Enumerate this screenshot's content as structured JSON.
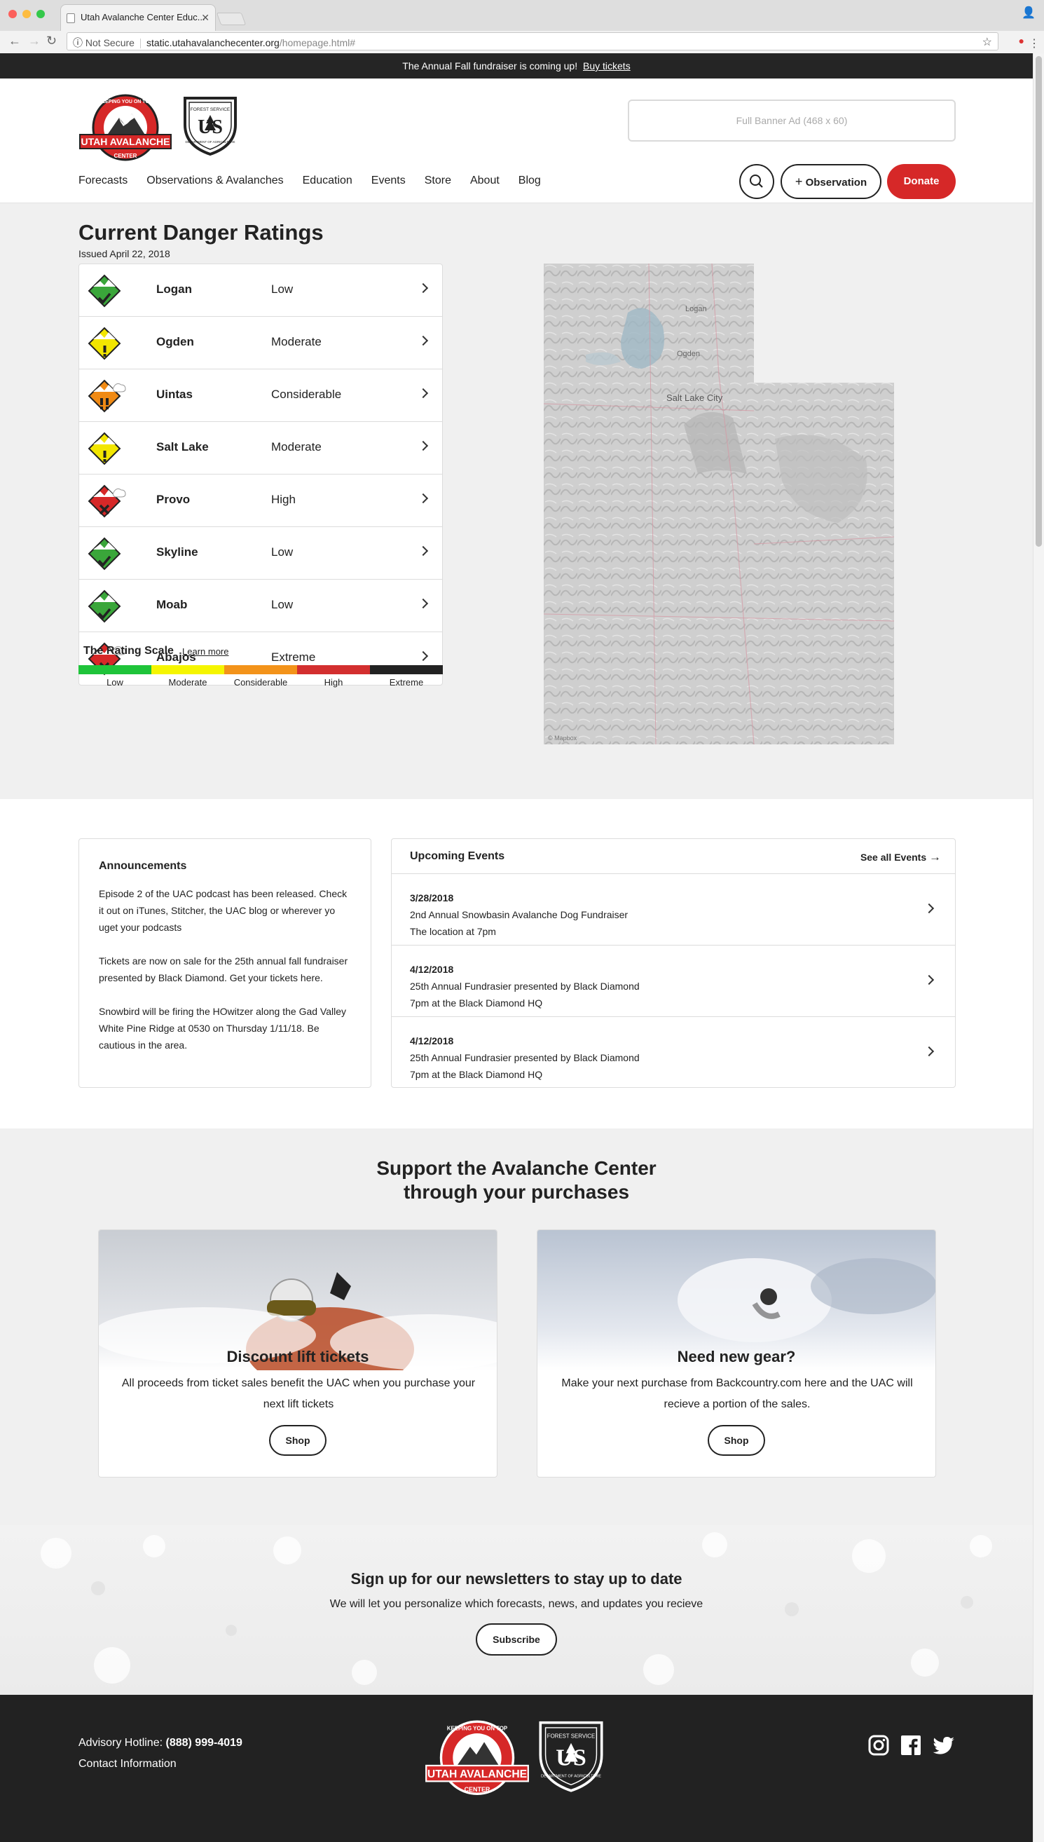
{
  "browser": {
    "tab_title": "Utah Avalanche Center Educ...",
    "secure_label": "Not Secure",
    "url_host": "static.utahavalanchecenter.org",
    "url_path": "/homepage.html#"
  },
  "promo": {
    "text": "The Annual Fall fundraiser is coming up!",
    "link": "Buy tickets"
  },
  "header": {
    "logo_top": "KEEPING YOU ON TOP",
    "logo_main": "UTAH AVALANCHE",
    "logo_sub": "CENTER",
    "fs_top": "FOREST SERVICE",
    "fs_mid": "US",
    "fs_bottom": "DEPARTMENT OF AGRICULTURE",
    "ad": "Full Banner Ad (468 x 60)",
    "nav": [
      "Forecasts",
      "Observations & Avalanches",
      "Education",
      "Events",
      "Store",
      "About",
      "Blog"
    ],
    "observation_btn": "Observation",
    "donate_btn": "Donate"
  },
  "danger": {
    "title": "Current Danger Ratings",
    "issued": "Issued April 22, 2018",
    "regions": [
      {
        "name": "Logan",
        "level": "Low",
        "color": "#3aa63a",
        "icon": "check-icon"
      },
      {
        "name": "Ogden",
        "level": "Moderate",
        "color": "#f2e600",
        "icon": "exclamation-icon"
      },
      {
        "name": "Uintas",
        "level": "Considerable",
        "color": "#f08a14",
        "icon": "double-exclamation-icon"
      },
      {
        "name": "Salt Lake",
        "level": "Moderate",
        "color": "#f2e600",
        "icon": "exclamation-icon"
      },
      {
        "name": "Provo",
        "level": "High",
        "color": "#d62828",
        "icon": "x-icon"
      },
      {
        "name": "Skyline",
        "level": "Low",
        "color": "#3aa63a",
        "icon": "check-icon"
      },
      {
        "name": "Moab",
        "level": "Low",
        "color": "#3aa63a",
        "icon": "check-icon"
      },
      {
        "name": "Abajos",
        "level": "Extreme",
        "color": "#d62828",
        "icon": "x-icon"
      }
    ],
    "scale_title": "The Rating Scale",
    "scale_link": "Learn more",
    "scale": [
      {
        "label": "Low",
        "color": "#1fc43a"
      },
      {
        "label": "Moderate",
        "color": "#f5f500"
      },
      {
        "label": "Considerable",
        "color": "#f3931a"
      },
      {
        "label": "High",
        "color": "#d32f2f"
      },
      {
        "label": "Extreme",
        "color": "#222222"
      }
    ],
    "map_labels": {
      "logan": "Logan",
      "ogden": "Ogden",
      "slc": "Salt Lake City",
      "credit": "© Mapbox"
    }
  },
  "announcements": {
    "title": "Announcements",
    "items": [
      "Episode 2 of the UAC podcast has been released. Check it out on iTunes, Stitcher, the UAC blog or wherever yo uget your podcasts",
      "Tickets are now on sale for the 25th annual fall fundraiser presented by Black Diamond. Get your tickets here.",
      "Snowbird will be firing the HOwitzer along the Gad Valley White Pine Ridge at 0530 on Thursday 1/11/18. Be cautious in the area."
    ]
  },
  "events": {
    "title": "Upcoming Events",
    "see_all": "See all Events",
    "items": [
      {
        "date": "3/28/2018",
        "name": "2nd Annual Snowbasin Avalanche Dog Fundraiser",
        "detail": "The location at 7pm"
      },
      {
        "date": "4/12/2018",
        "name": "25th Annual Fundrasier presented by Black Diamond",
        "detail": "7pm at the Black Diamond HQ"
      },
      {
        "date": "4/12/2018",
        "name": "25th Annual Fundrasier presented by Black Diamond",
        "detail": "7pm at the Black Diamond HQ"
      }
    ]
  },
  "support": {
    "title_line1": "Support the Avalanche Center",
    "title_line2": "through your purchases",
    "cards": [
      {
        "title": "Discount lift tickets",
        "text": "All proceeds from ticket sales benefit the UAC when you purchase your next lift tickets",
        "button": "Shop"
      },
      {
        "title": "Need new gear?",
        "text": "Make your next purchase from Backcountry.com here and the UAC will recieve a portion of the sales.",
        "button": "Shop"
      }
    ]
  },
  "newsletter": {
    "title": "Sign up for our newsletters to stay up to date",
    "text": "We will let you personalize which forecasts, news, and updates you recieve",
    "button": "Subscribe"
  },
  "footer": {
    "hotline_label": "Advisory Hotline:",
    "hotline_number": "(888) 999-4019",
    "contact": "Contact Information"
  },
  "colors": {
    "accent": "#d62828",
    "dark": "#222222",
    "bg_gray": "#f0f0f0"
  }
}
